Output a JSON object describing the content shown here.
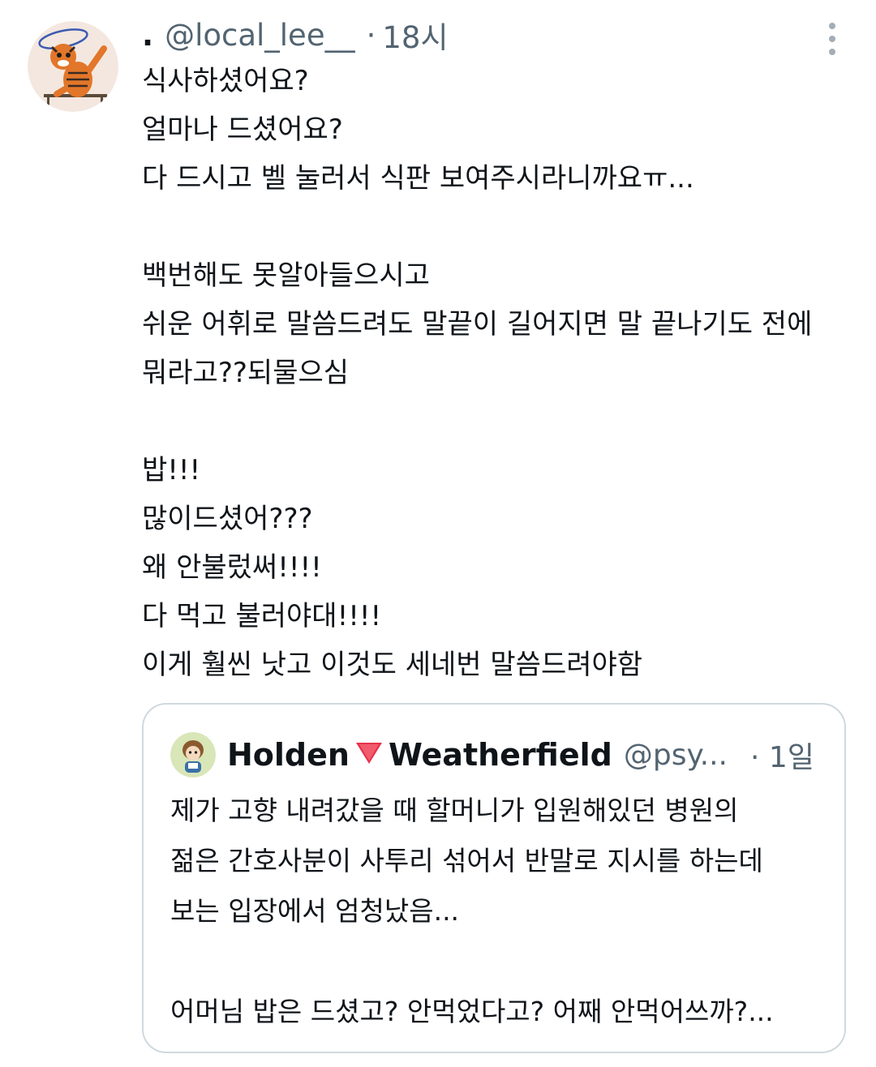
{
  "tweet": {
    "author_name": ".",
    "handle": "@local_lee__",
    "separator": "·",
    "time": "18시",
    "lines": [
      "식사하셨어요?",
      "얼마나 드셨어요?",
      "다 드시고 벨 눌러서 식판 보여주시라니까요ㅠ...",
      "",
      "백번해도 못알아들으시고",
      "쉬운 어휘로 말씀드려도 말끝이 길어지면 말 끝나기도 전에",
      "뭐라고??되물으심",
      "",
      "밥!!!",
      "많이드셨어???",
      "왜 안불렀써!!!!",
      "다 먹고 불러야대!!!!",
      "이게 훨씬 낫고 이것도 세네번 말씀드려야함"
    ]
  },
  "quoted": {
    "name_part1": "Holden",
    "name_emoji": "🔻",
    "name_part2": "Weatherfield",
    "handle": "@psy...",
    "separator": "·",
    "time": "1일",
    "lines": [
      "제가 고향 내려갔을 때 할머니가 입원해있던 병원의",
      "젊은 간호사분이 사투리 섞어서 반말로 지시를 하는데",
      "보는 입장에서 엄청났음...",
      "",
      "어머님 밥은 드셨고? 안먹었다고? 어째 안먹어쓰까?..."
    ]
  },
  "icons": {
    "more": "more-vertical-icon",
    "avatar": "tiger-mascot-avatar",
    "quoted_avatar": "cartoon-person-avatar"
  },
  "colors": {
    "text": "#0f1419",
    "secondary": "#536471",
    "border": "#cfd9de",
    "emoji_red": "#e8324a"
  }
}
